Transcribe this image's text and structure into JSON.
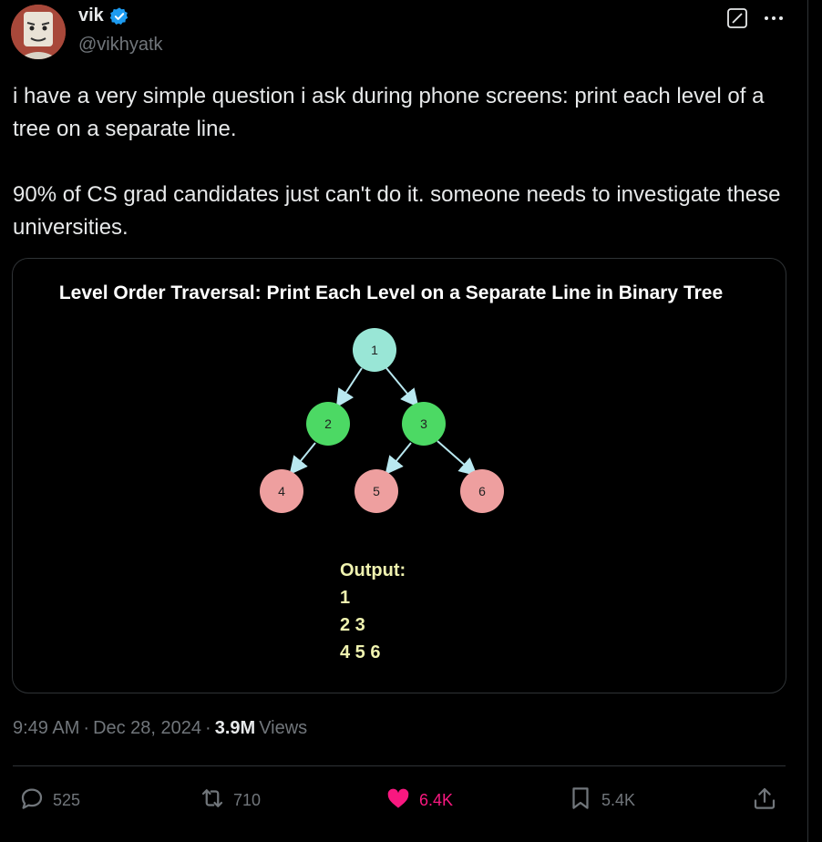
{
  "author": {
    "name": "vik",
    "handle": "@vikhyatk",
    "verified_color": "#1d9bf0"
  },
  "tweet": {
    "paragraphs": [
      "i have a very simple question i ask during phone screens: print each level of a tree on a separate line.",
      "90% of CS grad candidates just can't do it. someone needs to investigate these universities."
    ]
  },
  "media": {
    "title": "Level Order Traversal: Print Each Level on a Separate Line in Binary Tree",
    "nodes": [
      {
        "label": "1",
        "color": "#99e6d6"
      },
      {
        "label": "2",
        "color": "#4cd964"
      },
      {
        "label": "3",
        "color": "#4cd964"
      },
      {
        "label": "4",
        "color": "#ee9f9f"
      },
      {
        "label": "5",
        "color": "#ee9f9f"
      },
      {
        "label": "6",
        "color": "#ee9f9f"
      }
    ],
    "output_heading": "Output:",
    "output_lines": [
      "1",
      "2 3",
      "4 5 6"
    ],
    "output_color": "#f0f3b0",
    "edge_color": "#b9e8f0"
  },
  "meta": {
    "time": "9:49 AM",
    "separator": "·",
    "date": "Dec 28, 2024",
    "views_count": "3.9M",
    "views_label": "Views"
  },
  "actions": {
    "replies": "525",
    "reposts": "710",
    "likes": "6.4K",
    "bookmarks": "5.4K",
    "like_color": "#f91880"
  },
  "icons": [
    "verified-icon",
    "grok-icon",
    "more-icon",
    "reply-icon",
    "repost-icon",
    "like-icon",
    "bookmark-icon",
    "share-icon"
  ]
}
